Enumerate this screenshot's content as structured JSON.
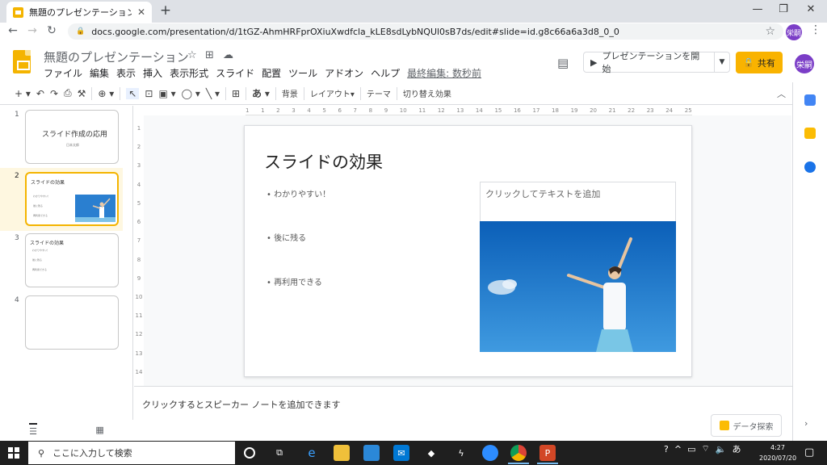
{
  "browser": {
    "tab_title": "無題のプレゼンテーション - Google ス",
    "tab_close": "✕",
    "new_tab": "+",
    "window_controls": {
      "minimize": "—",
      "restore": "❐",
      "close": "✕"
    },
    "url": "docs.google.com/presentation/d/1tGZ-AhmHRFprOXiuXwdfcla_kLE8sdLybNQUl0sB7ds/edit#slide=id.g8c66a6a3d8_0_0",
    "nav": {
      "back": "←",
      "forward": "→",
      "reload": "↻"
    },
    "profile_initials": "栄嗣"
  },
  "app": {
    "doc_title": "無題のプレゼンテーション",
    "menu": [
      "ファイル",
      "編集",
      "表示",
      "挿入",
      "表示形式",
      "スライド",
      "配置",
      "ツール",
      "アドオン",
      "ヘルプ"
    ],
    "last_edit": "最終編集: 数秒前",
    "present_label": "プレゼンテーションを開始",
    "share_label": "共有",
    "user_initials": "栄嗣",
    "brand_color": "#f4b400",
    "share_color": "#f9b300"
  },
  "toolbar": {
    "bg_label": "背景",
    "layout_label": "レイアウト",
    "theme_label": "テーマ",
    "transition_label": "切り替え効果",
    "text_style": "あ"
  },
  "rulers": {
    "horizontal": [
      "1",
      "1",
      "2",
      "3",
      "4",
      "5",
      "6",
      "7",
      "8",
      "9",
      "10",
      "11",
      "12",
      "13",
      "14",
      "15",
      "16",
      "17",
      "18",
      "19",
      "20",
      "21",
      "22",
      "23",
      "24",
      "25"
    ],
    "vertical": [
      "1",
      "2",
      "3",
      "4",
      "5",
      "6",
      "7",
      "8",
      "9",
      "10",
      "11",
      "12",
      "13",
      "14"
    ]
  },
  "filmstrip": {
    "slides": [
      {
        "num": "1",
        "title": "スライド作成の応用",
        "subtitle": "日本太郎"
      },
      {
        "num": "2",
        "title": "スライドの効果",
        "bullets": [
          "わかりやすい！",
          "後に残る",
          "再利用できる"
        ]
      },
      {
        "num": "3",
        "title": "スライドの効果",
        "bullets": [
          "わかりやすい！",
          "後に残る",
          "再利用できる"
        ]
      },
      {
        "num": "4"
      }
    ]
  },
  "slide": {
    "title": "スライドの効果",
    "bullets": [
      "• わかりやすい！",
      "• 後に残る",
      "• 再利用できる"
    ],
    "placeholder": "クリックしてテキストを追加"
  },
  "speaker_notes_placeholder": "クリックするとスピーカー ノートを追加できます",
  "explore_label": "データ探索",
  "taskbar": {
    "search_placeholder": "ここに入力して検索",
    "time": "4:27",
    "date": "2020/07/20",
    "ime": "あ"
  }
}
